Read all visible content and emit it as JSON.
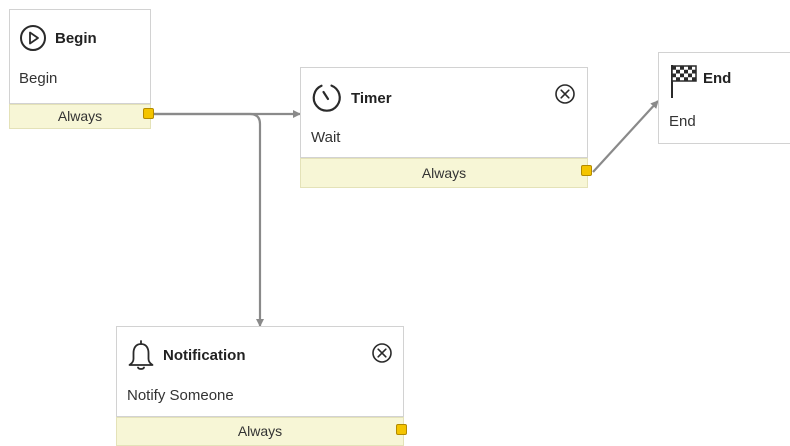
{
  "nodes": {
    "begin": {
      "title": "Begin",
      "subtitle": "Begin",
      "outcome": "Always",
      "icon": "play-circle-icon"
    },
    "timer": {
      "title": "Timer",
      "subtitle": "Wait",
      "outcome": "Always",
      "icon": "timer-icon"
    },
    "end": {
      "title": "End",
      "subtitle": "End",
      "icon": "checkered-flag-icon"
    },
    "notification": {
      "title": "Notification",
      "subtitle": "Notify Someone",
      "outcome": "Always",
      "icon": "bell-icon"
    }
  },
  "connections": [
    {
      "from": "Begin",
      "outcome": "Always",
      "to": "Timer"
    },
    {
      "from": "Begin",
      "outcome": "Always",
      "to": "Notification"
    },
    {
      "from": "Timer",
      "outcome": "Always",
      "to": "End"
    }
  ],
  "colors": {
    "outcome_bar": "#f7f6d6",
    "port": "#f4c400",
    "connector": "#8a8a8a",
    "node_border": "#d2d2d2"
  }
}
